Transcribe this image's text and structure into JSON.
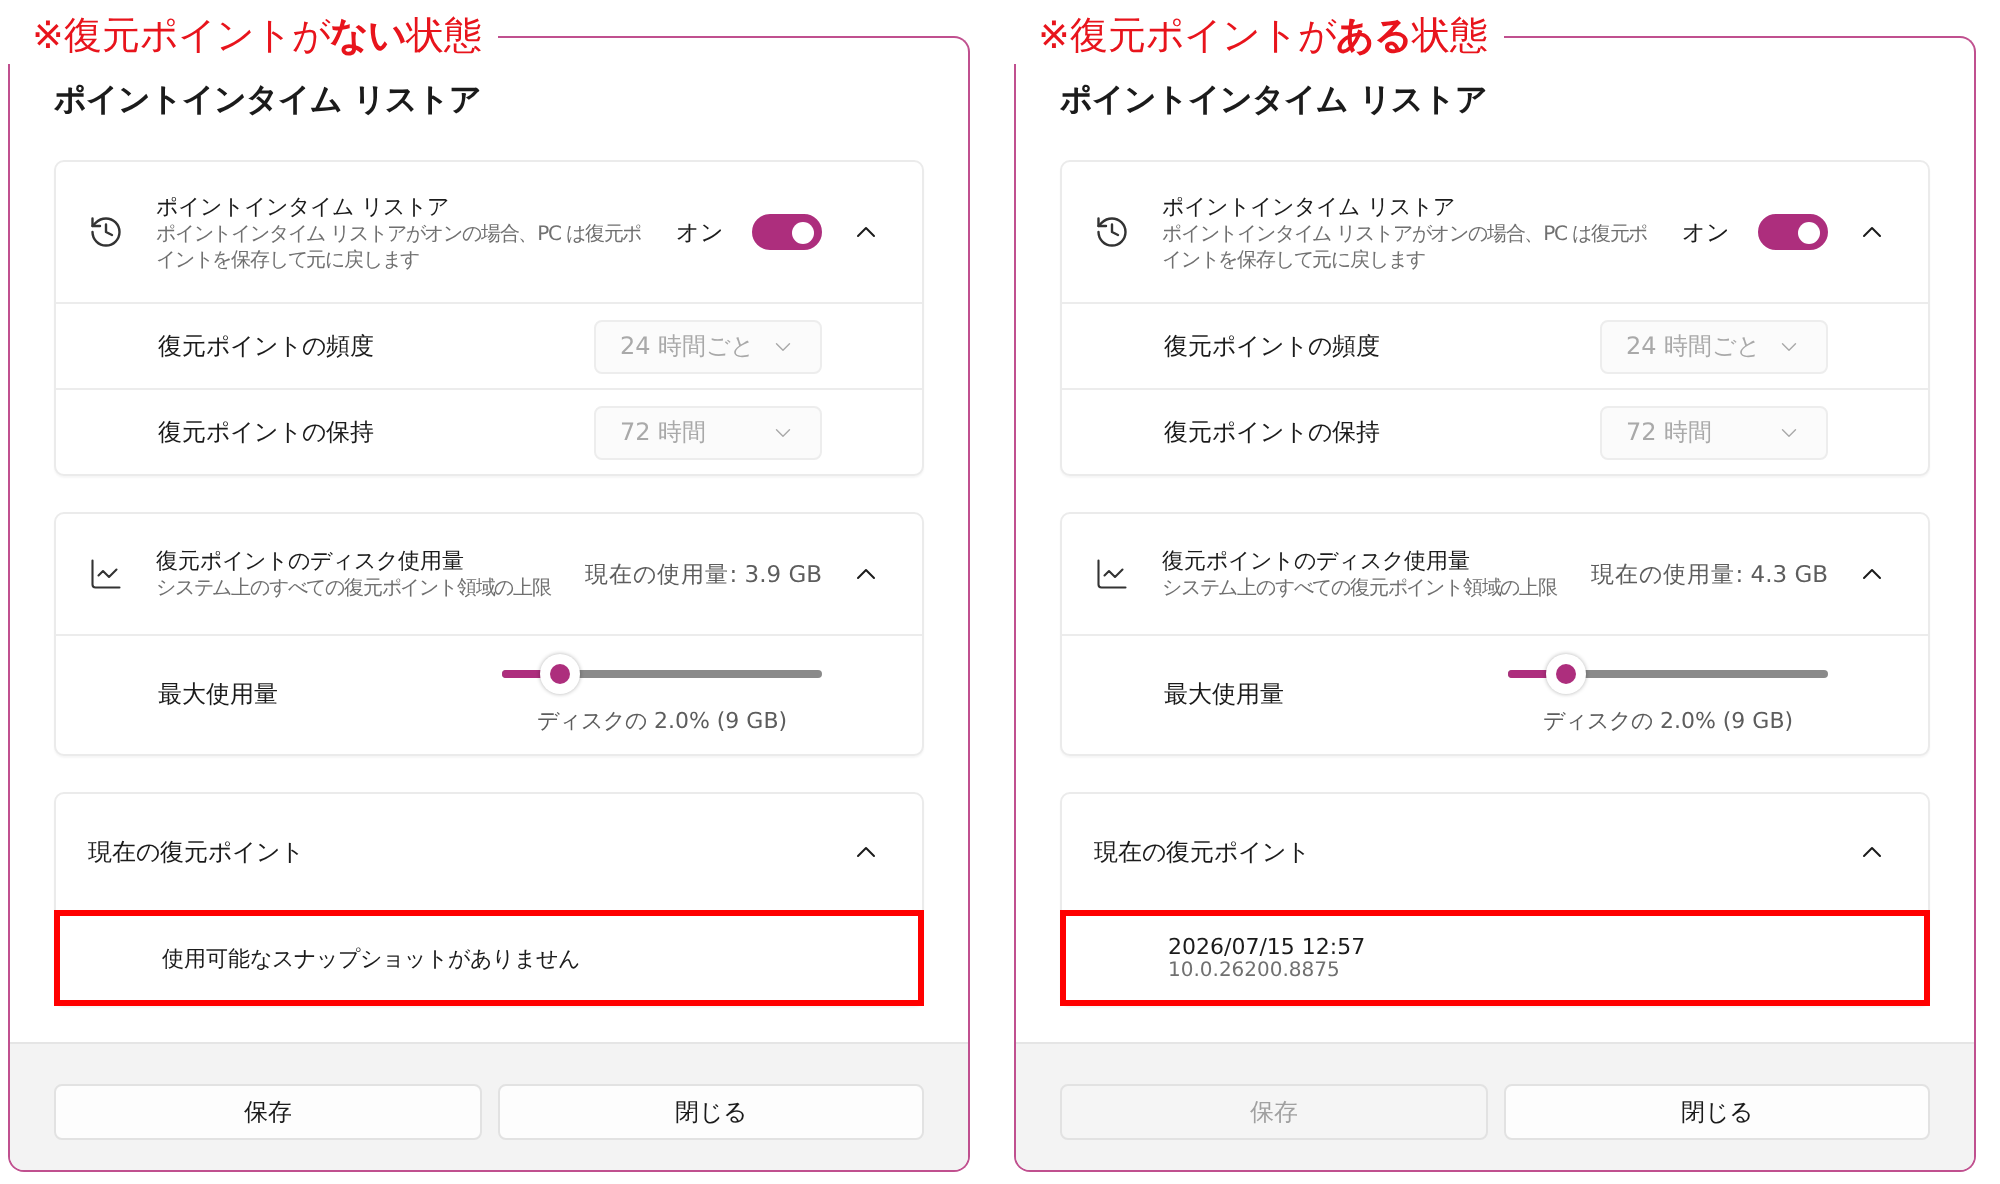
{
  "panels": [
    {
      "caption": "※復元ポイントが**ない**状態",
      "title": "ポイントインタイム リストア",
      "restore_card": {
        "title": "ポイントインタイム リストア",
        "description": "ポイントインタイム リストアがオンの場合、PC は復元ポイントを保存して元に戻します",
        "toggle_label": "オン",
        "on": true,
        "expanded": true,
        "rows": [
          {
            "label": "復元ポイントの頻度",
            "value": "24 時間ごと",
            "disabled": true
          },
          {
            "label": "復元ポイントの保持",
            "value": "72 時間",
            "disabled": true
          }
        ]
      },
      "disk_card": {
        "title": "復元ポイントのディスク使用量",
        "description": "システム上のすべての復元ポイント領域の上限",
        "usage": "現在の使用量: 3.9 GB",
        "expanded": true,
        "max_label": "最大使用量",
        "level": 0.18,
        "reading": "ディスクの 2.0% (9 GB)"
      },
      "points_card": {
        "title": "現在の復元ポイント",
        "expanded": true,
        "items": [
          {
            "kind": "empty",
            "text": "使用可能なスナップショットがありません",
            "highlighted": true
          }
        ]
      },
      "buttons": [
        {
          "label": "保存",
          "disabled": false
        },
        {
          "label": "閉じる",
          "disabled": false
        }
      ]
    },
    {
      "caption": "※復元ポイントが**ある**状態",
      "title": "ポイントインタイム リストア",
      "restore_card": {
        "title": "ポイントインタイム リストア",
        "description": "ポイントインタイム リストアがオンの場合、PC は復元ポイントを保存して元に戻します",
        "toggle_label": "オン",
        "on": true,
        "expanded": true,
        "rows": [
          {
            "label": "復元ポイントの頻度",
            "value": "24 時間ごと",
            "disabled": true
          },
          {
            "label": "復元ポイントの保持",
            "value": "72 時間",
            "disabled": true
          }
        ]
      },
      "disk_card": {
        "title": "復元ポイントのディスク使用量",
        "description": "システム上のすべての復元ポイント領域の上限",
        "usage": "現在の使用量: 4.3 GB",
        "expanded": true,
        "max_label": "最大使用量",
        "level": 0.18,
        "reading": "ディスクの 2.0% (9 GB)"
      },
      "points_card": {
        "title": "現在の復元ポイント",
        "expanded": true,
        "items": [
          {
            "kind": "point",
            "date": "2026/07/15 12:57",
            "version": "10.0.26200.8875",
            "highlighted": true
          }
        ]
      },
      "buttons": [
        {
          "label": "保存",
          "disabled": true
        },
        {
          "label": "閉じる",
          "disabled": false
        }
      ]
    }
  ]
}
